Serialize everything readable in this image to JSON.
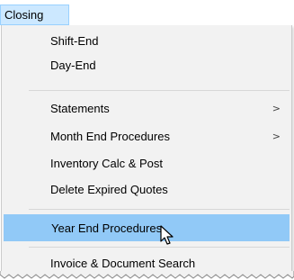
{
  "menubar": {
    "title": "Closing"
  },
  "menu": {
    "items": [
      {
        "label": "Shift-End",
        "submenu": false
      },
      {
        "label": "Day-End",
        "submenu": false
      },
      {
        "label": "Statements",
        "submenu": true
      },
      {
        "label": "Month End Procedures",
        "submenu": true
      },
      {
        "label": "Inventory Calc & Post",
        "submenu": false
      },
      {
        "label": "Delete Expired Quotes",
        "submenu": false
      },
      {
        "label": "Year End Procedures",
        "submenu": false,
        "highlighted": true
      },
      {
        "label": "Invoice & Document Search",
        "submenu": false
      }
    ],
    "submenu_arrow": ">"
  },
  "colors": {
    "highlight": "#91c9f7",
    "menubar_active": "#cce8ff"
  },
  "icons": {
    "cursor": "mouse-pointer-icon"
  }
}
